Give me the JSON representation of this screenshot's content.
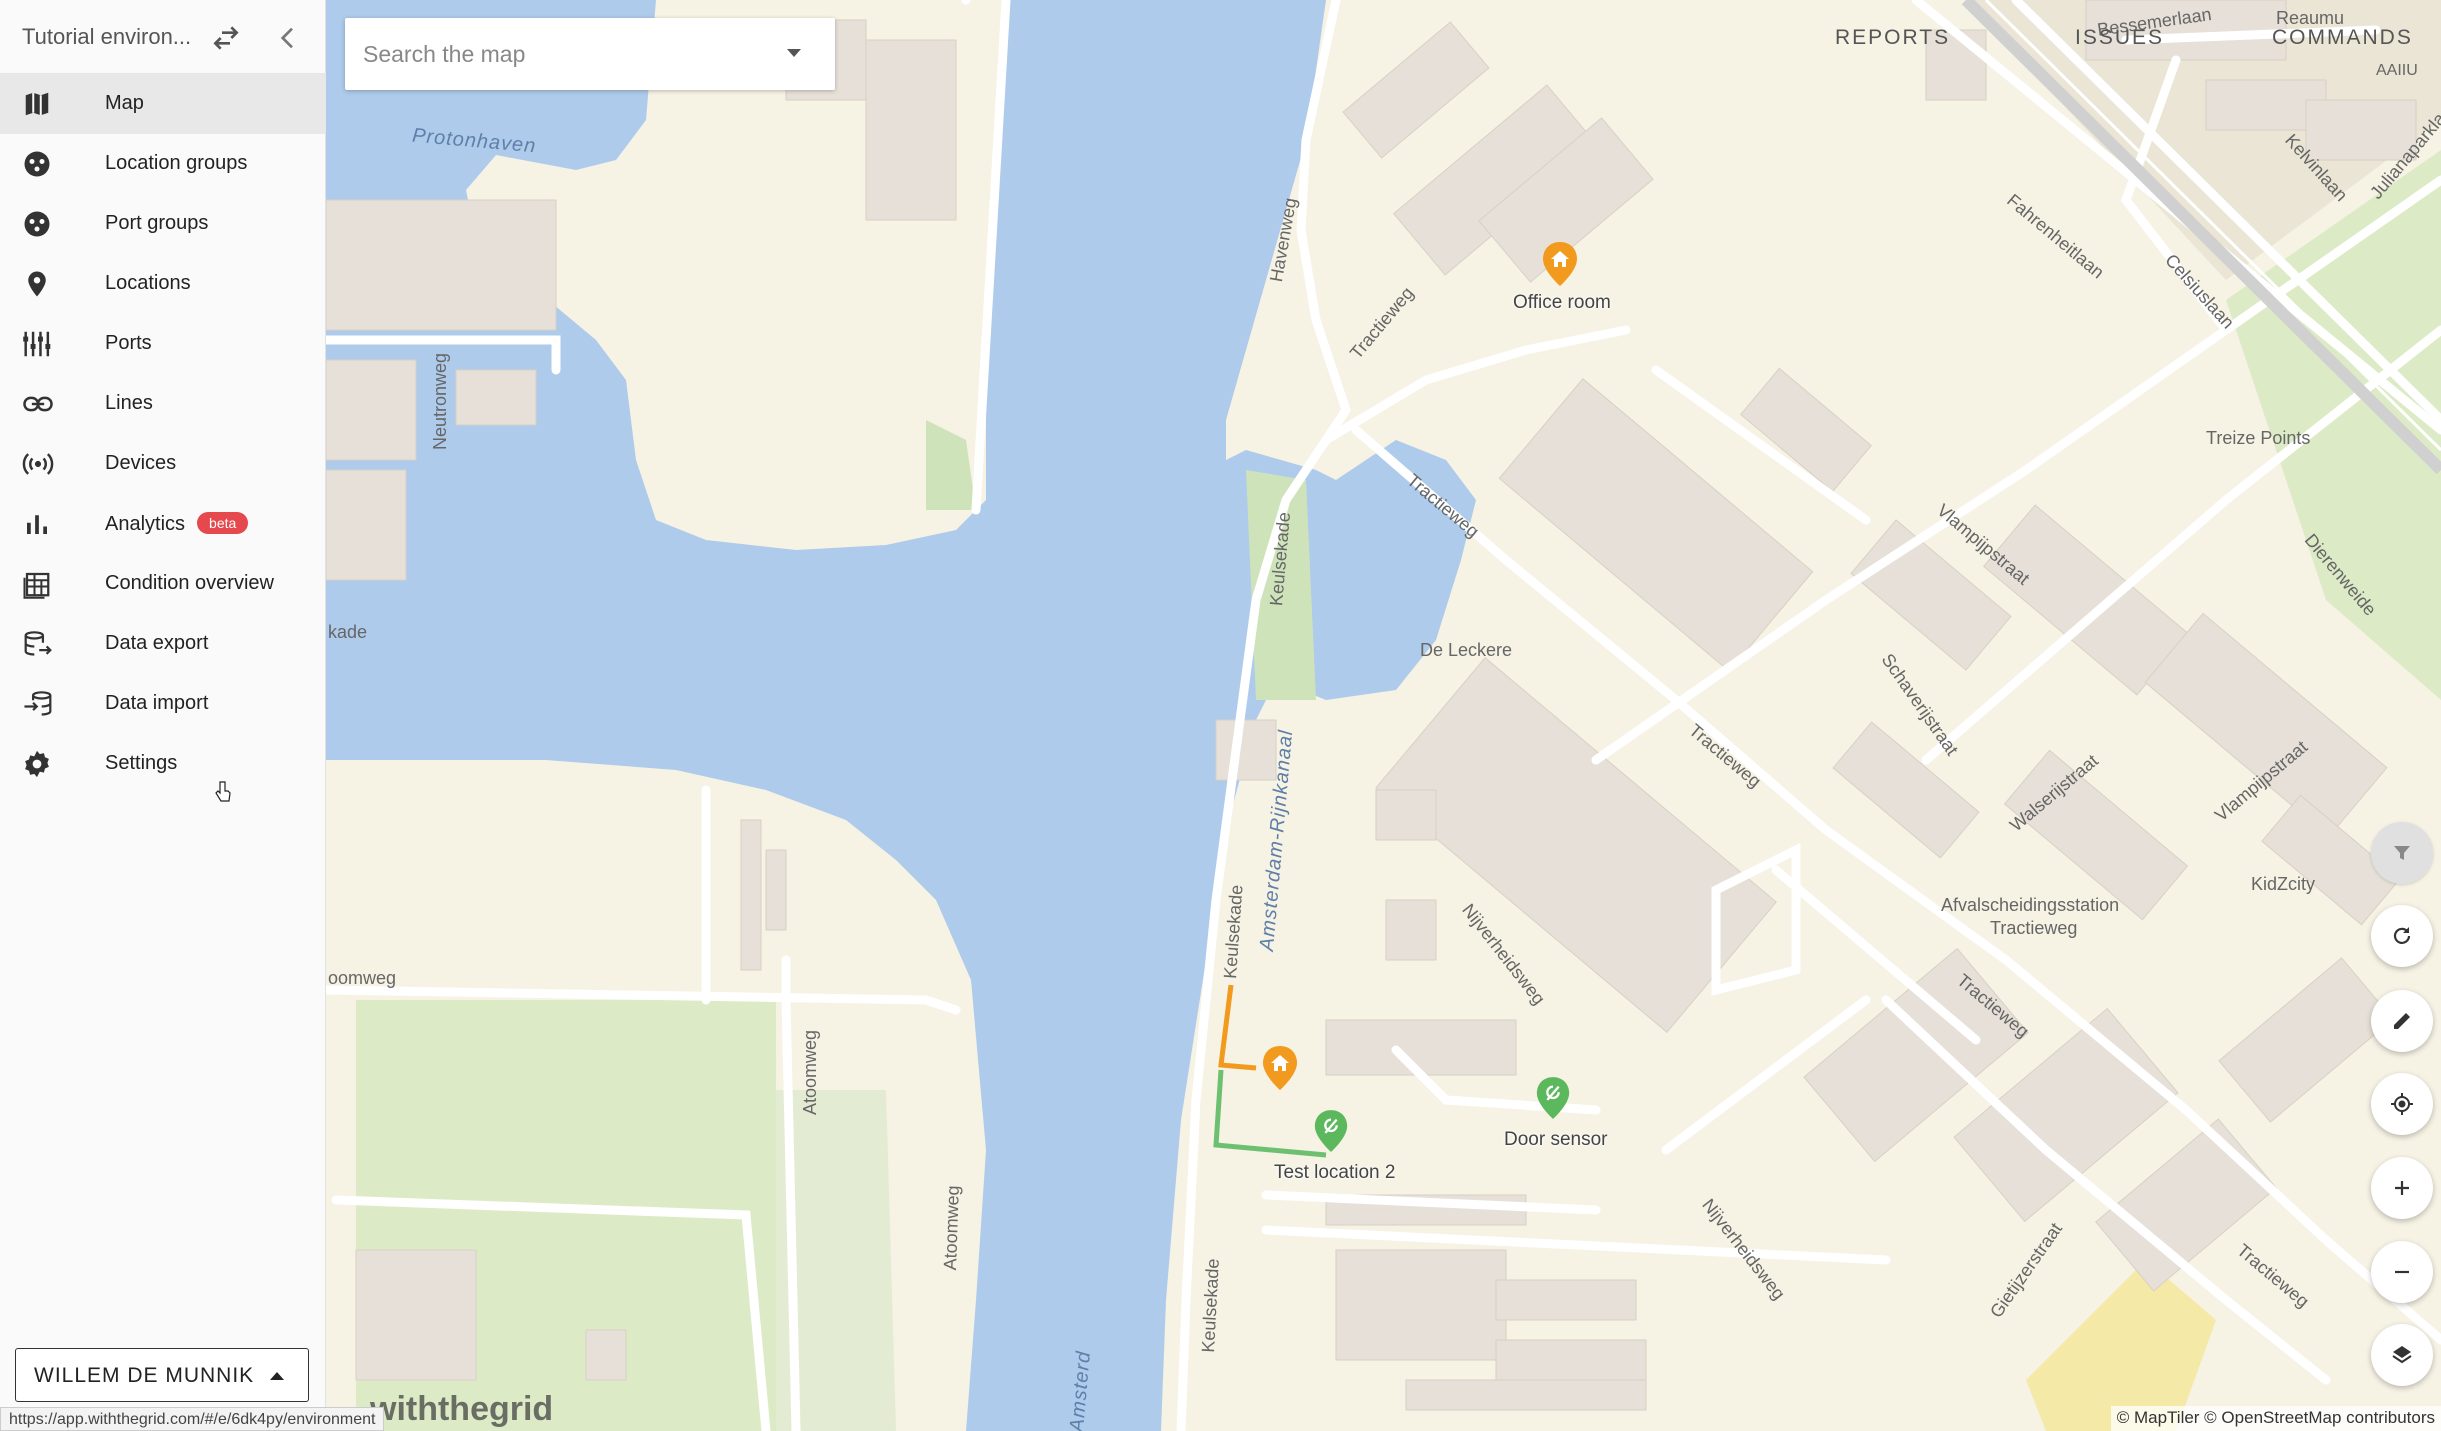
{
  "sidebar": {
    "environment_name": "Tutorial environ...",
    "nav": [
      {
        "label": "Map",
        "icon": "map-icon"
      },
      {
        "label": "Location groups",
        "icon": "location-groups-icon"
      },
      {
        "label": "Port groups",
        "icon": "port-groups-icon"
      },
      {
        "label": "Locations",
        "icon": "location-pin-icon"
      },
      {
        "label": "Ports",
        "icon": "ports-icon"
      },
      {
        "label": "Lines",
        "icon": "link-icon"
      },
      {
        "label": "Devices",
        "icon": "wireless-icon"
      },
      {
        "label": "Analytics",
        "icon": "bar-chart-icon",
        "badge": "beta"
      },
      {
        "label": "Condition overview",
        "icon": "table-icon"
      },
      {
        "label": "Data export",
        "icon": "data-export-icon"
      },
      {
        "label": "Data import",
        "icon": "data-import-icon"
      },
      {
        "label": "Settings",
        "icon": "gear-icon"
      }
    ],
    "active_item": "Map",
    "user_name": "WILLEM DE MUNNIK"
  },
  "status_bar": {
    "url": "https://app.withthegrid.com/#/e/6dk4py/environment"
  },
  "map": {
    "search": {
      "placeholder": "Search the map",
      "value": ""
    },
    "top_links": {
      "reports": "REPORTS",
      "issues": "ISSUES",
      "commands": "COMMANDS"
    },
    "attribution": "© MapTiler © OpenStreetMap contributors",
    "watermark": "withthegrid",
    "labels": {
      "protonhaven": "Protonhaven",
      "amsterdam_rijnkanaal": "Amsterdam-Rijnkanaal",
      "amsterdam_rijnkanaal_2": "Amsterd",
      "neutronweg": "Neutronweg",
      "kade": "kade",
      "oomweg": "oomweg",
      "atoomweg": "Atoomweg",
      "atoomweg_2": "Atoomweg",
      "havenweg": "Havenweg",
      "tractieweg_1": "Tractieweg",
      "tractieweg_2": "Tractieweg",
      "tractieweg_3": "Tractieweg",
      "tractieweg_4": "Tractieweg",
      "tractieweg_5": "Tractieweg",
      "keulsekade_1": "Keulsekade",
      "keulsekade_2": "Keulsekade",
      "keulsekade_3": "Keulsekade",
      "de_leckere": "De Leckere",
      "nijverheidsweg_1": "Nijverheidsweg",
      "nijverheidsweg_2": "Nijverheidsweg",
      "schaverijstraat": "Schaverijstraat",
      "walserijstraat": "Walserijstraat",
      "vlampijpstraat_1": "Vlampijpstraat",
      "vlampijpstraat_2": "Vlampijpstraat",
      "afvalscheidingsstation": "Afvalscheidingsstation",
      "afvalscheidingsstation_2": "Tractieweg",
      "kidzcity": "KidZcity",
      "treize_points": "Treize Points",
      "dierenweide": "Dierenweide",
      "bessemerlaan": "Bessemerlaan",
      "fahrenheitlaan": "Fahrenheitlaan",
      "celsiuslaan": "Celsiuslaan",
      "kelvinlaan": "Kelvinlaan",
      "julianaparklaan": "Julianaparklaan",
      "reaumur": "Reaumu",
      "aaiiu": "AAIIU",
      "gietijzerstraat": "Gietijzerstraat"
    },
    "markers": [
      {
        "label": "Office room",
        "type": "home",
        "color": "#f29a1d"
      },
      {
        "label": "",
        "type": "home",
        "color": "#f29a1d"
      },
      {
        "label": "Test location 2",
        "type": "sensor",
        "color": "#5cb85c"
      },
      {
        "label": "Door sensor",
        "type": "sensor",
        "color": "#5cb85c"
      }
    ],
    "line_colors": {
      "orange": "#f29a1d",
      "green": "#6cc070"
    },
    "controls": [
      "filter-icon",
      "refresh-icon",
      "edit-icon",
      "my-location-icon",
      "zoom-in-icon",
      "zoom-out-icon",
      "layers-icon"
    ]
  },
  "colors": {
    "water": "#aecbeb",
    "land": "#f6f2e4",
    "park": "#dcebc6",
    "building": "#e6e0d8",
    "badge": "#e5484d"
  }
}
